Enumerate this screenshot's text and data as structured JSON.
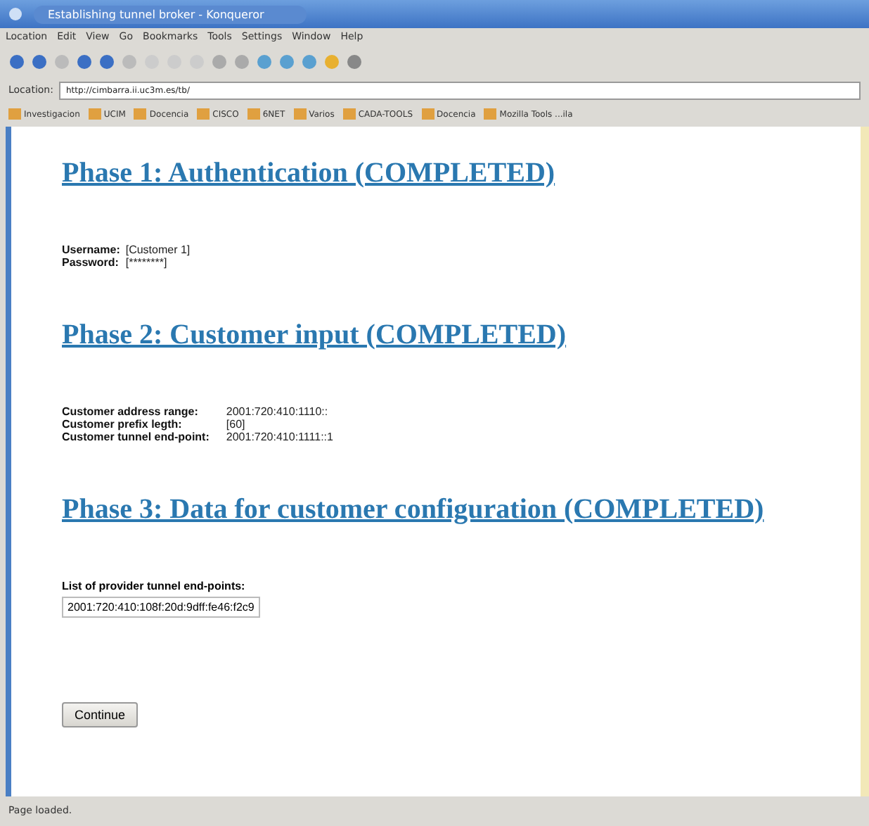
{
  "window": {
    "title": "Establishing tunnel broker - Konqueror"
  },
  "menu": [
    "Location",
    "Edit",
    "View",
    "Go",
    "Bookmarks",
    "Tools",
    "Settings",
    "Window",
    "Help"
  ],
  "location": {
    "label": "Location:",
    "value": "http://cimbarra.ii.uc3m.es/tb/"
  },
  "bookmarks": [
    "Investigacion",
    "UCIM",
    "Docencia",
    "CISCO",
    "6NET",
    "Varios",
    "CADA-TOOLS",
    "Docencia",
    "Mozilla Tools ...ila"
  ],
  "sections": [
    {
      "heading": "Phase 1: Authentication (COMPLETED)",
      "fields": [
        {
          "label": "Username:",
          "value": "[Customer 1]"
        },
        {
          "label": "Password:",
          "value": "[********]"
        }
      ]
    },
    {
      "heading": "Phase 2: Customer input (COMPLETED)",
      "fields": [
        {
          "label": "Customer address range:",
          "value": "2001:720:410:1110::"
        },
        {
          "label": "Customer prefix legth:",
          "value": "[60]"
        },
        {
          "label": "Customer tunnel end-point:",
          "value": "2001:720:410:1111::1"
        }
      ]
    },
    {
      "heading": "Phase 3: Data for customer configuration (COMPLETED)",
      "list_label": "List of provider tunnel end-points:",
      "list_items": [
        "2001:720:410:108f:20d:9dff:fe46:f2c9"
      ]
    }
  ],
  "continue_button": "Continue",
  "status_bar": "Page loaded."
}
